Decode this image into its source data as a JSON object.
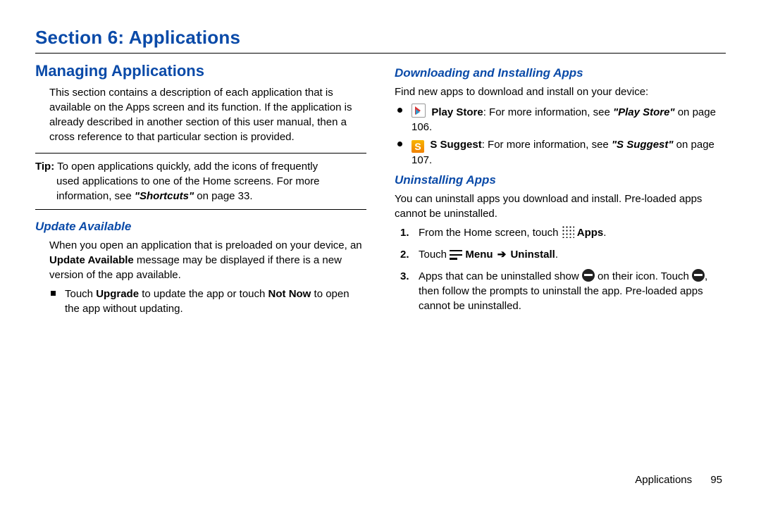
{
  "section_title": "Section 6: Applications",
  "left": {
    "h2": "Managing Applications",
    "intro": "This section contains a description of each application that is available on the Apps screen and its function. If the application is already described in another section of this user manual, then a cross reference to that particular section is provided.",
    "tip_label": "Tip:",
    "tip_line1": "To open applications quickly, add the icons of frequently",
    "tip_line2": "used applications to one of the Home screens. For more",
    "tip_line3_a": "information, see ",
    "tip_ref": "\"Shortcuts\"",
    "tip_line3_b": " on page 33.",
    "h3_update": "Update Available",
    "update_p": "When you open an application that is preloaded on your device, an ",
    "update_bold": "Update Available",
    "update_p2": " message may be displayed if there is a new version of the app available.",
    "update_li_a": "Touch ",
    "update_li_b1": "Upgrade",
    "update_li_mid": " to update the app or touch ",
    "update_li_b2": "Not Now",
    "update_li_c": " to open the app without updating."
  },
  "right": {
    "h3_dl": "Downloading and Installing Apps",
    "dl_intro": "Find new apps to download and install on your device:",
    "play_label": "Play Store",
    "play_text_a": ": For more information, see ",
    "play_ref": "\"Play Store\"",
    "play_text_b": " on page 106.",
    "ss_label": "S Suggest",
    "ss_text_a": ": For more information, see ",
    "ss_ref": "\"S Suggest\"",
    "ss_text_b": " on page 107.",
    "ss_icon_letter": "S",
    "h3_un": "Uninstalling Apps",
    "un_intro": "You can uninstall apps you download and install. Pre-loaded apps cannot be uninstalled.",
    "step1_a": "From the Home screen, touch ",
    "step1_apps": "Apps",
    "step1_b": ".",
    "step2_a": "Touch ",
    "step2_menu": "Menu",
    "step2_arrow": "➔",
    "step2_uninstall": "Uninstall",
    "step2_b": ".",
    "step3_a": "Apps that can be uninstalled show ",
    "step3_b": " on their icon. Touch ",
    "step3_c": ", then follow the prompts to uninstall the app. Pre-loaded apps cannot be uninstalled."
  },
  "footer": {
    "label": "Applications",
    "page": "95"
  }
}
